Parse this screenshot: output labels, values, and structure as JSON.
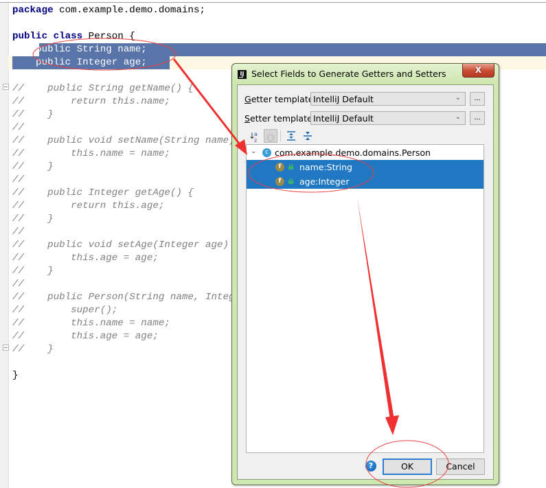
{
  "editor": {
    "lines": [
      {
        "tokens": [
          {
            "t": "package",
            "c": "kw"
          },
          {
            "t": " com.example.demo.domains;",
            "c": "pl"
          }
        ]
      },
      {
        "tokens": []
      },
      {
        "tokens": [
          {
            "t": "public class",
            "c": "kw"
          },
          {
            "t": " Person {",
            "c": "pl"
          }
        ]
      },
      {
        "tokens": [
          {
            "t": "    public String name;",
            "c": "sel"
          }
        ]
      },
      {
        "tokens": [
          {
            "t": "    public Integer age;",
            "c": "sel"
          }
        ]
      },
      {
        "tokens": []
      },
      {
        "tokens": [
          {
            "t": "//    public String getName() {",
            "c": "cm"
          }
        ]
      },
      {
        "tokens": [
          {
            "t": "//        return this.name;",
            "c": "cm"
          }
        ]
      },
      {
        "tokens": [
          {
            "t": "//    }",
            "c": "cm"
          }
        ]
      },
      {
        "tokens": [
          {
            "t": "//",
            "c": "cm"
          }
        ]
      },
      {
        "tokens": [
          {
            "t": "//    public void setName(String name) {",
            "c": "cm"
          }
        ]
      },
      {
        "tokens": [
          {
            "t": "//        this.name = name;",
            "c": "cm"
          }
        ]
      },
      {
        "tokens": [
          {
            "t": "//    }",
            "c": "cm"
          }
        ]
      },
      {
        "tokens": [
          {
            "t": "//",
            "c": "cm"
          }
        ]
      },
      {
        "tokens": [
          {
            "t": "//    public Integer getAge() {",
            "c": "cm"
          }
        ]
      },
      {
        "tokens": [
          {
            "t": "//        return this.age;",
            "c": "cm"
          }
        ]
      },
      {
        "tokens": [
          {
            "t": "//    }",
            "c": "cm"
          }
        ]
      },
      {
        "tokens": [
          {
            "t": "//",
            "c": "cm"
          }
        ]
      },
      {
        "tokens": [
          {
            "t": "//    public void setAge(Integer age) {",
            "c": "cm"
          }
        ]
      },
      {
        "tokens": [
          {
            "t": "//        this.age = age;",
            "c": "cm"
          }
        ]
      },
      {
        "tokens": [
          {
            "t": "//    }",
            "c": "cm"
          }
        ]
      },
      {
        "tokens": [
          {
            "t": "//",
            "c": "cm"
          }
        ]
      },
      {
        "tokens": [
          {
            "t": "//    public Person(String name, Integer age) {",
            "c": "cm"
          }
        ]
      },
      {
        "tokens": [
          {
            "t": "//        super();",
            "c": "cm"
          }
        ]
      },
      {
        "tokens": [
          {
            "t": "//        this.name = name;",
            "c": "cm"
          }
        ]
      },
      {
        "tokens": [
          {
            "t": "//        this.age = age;",
            "c": "cm"
          }
        ]
      },
      {
        "tokens": [
          {
            "t": "//    }",
            "c": "cm"
          }
        ]
      },
      {
        "tokens": []
      },
      {
        "tokens": [
          {
            "t": "}",
            "c": "pl"
          }
        ]
      }
    ],
    "selection_color": "#5874a8",
    "caret_line_color": "#fdf8e4"
  },
  "dialog": {
    "title": "Select Fields to Generate Getters and Setters",
    "app_icon": "IJ",
    "close_label": "X",
    "getter": {
      "label_mnemonic": "G",
      "label_rest": "etter template:",
      "value": "IntelliJ Default",
      "more_label": "..."
    },
    "setter": {
      "label_mnemonic": "S",
      "label_rest": "etter template:",
      "value": "IntelliJ Default",
      "more_label": "..."
    },
    "toolbar": {
      "sort_icon": "sort-alphabetically-icon",
      "class_toggle_icon": "show-classes-icon",
      "expand_icon": "expand-all-icon",
      "collapse_icon": "collapse-all-icon"
    },
    "tree": {
      "class_name": "com.example.demo.domains.Person",
      "class_icon_letter": "c",
      "fields": [
        {
          "label": "name:String",
          "icon_letter": "f",
          "selected": true
        },
        {
          "label": "age:Integer",
          "icon_letter": "f",
          "selected": true
        }
      ]
    },
    "help_label": "?",
    "ok_label": "OK",
    "cancel_label": "Cancel"
  },
  "colors": {
    "annotation_red": "#f03030",
    "tree_selection": "#2077c2",
    "keyword": "#000080",
    "comment": "#808080"
  }
}
